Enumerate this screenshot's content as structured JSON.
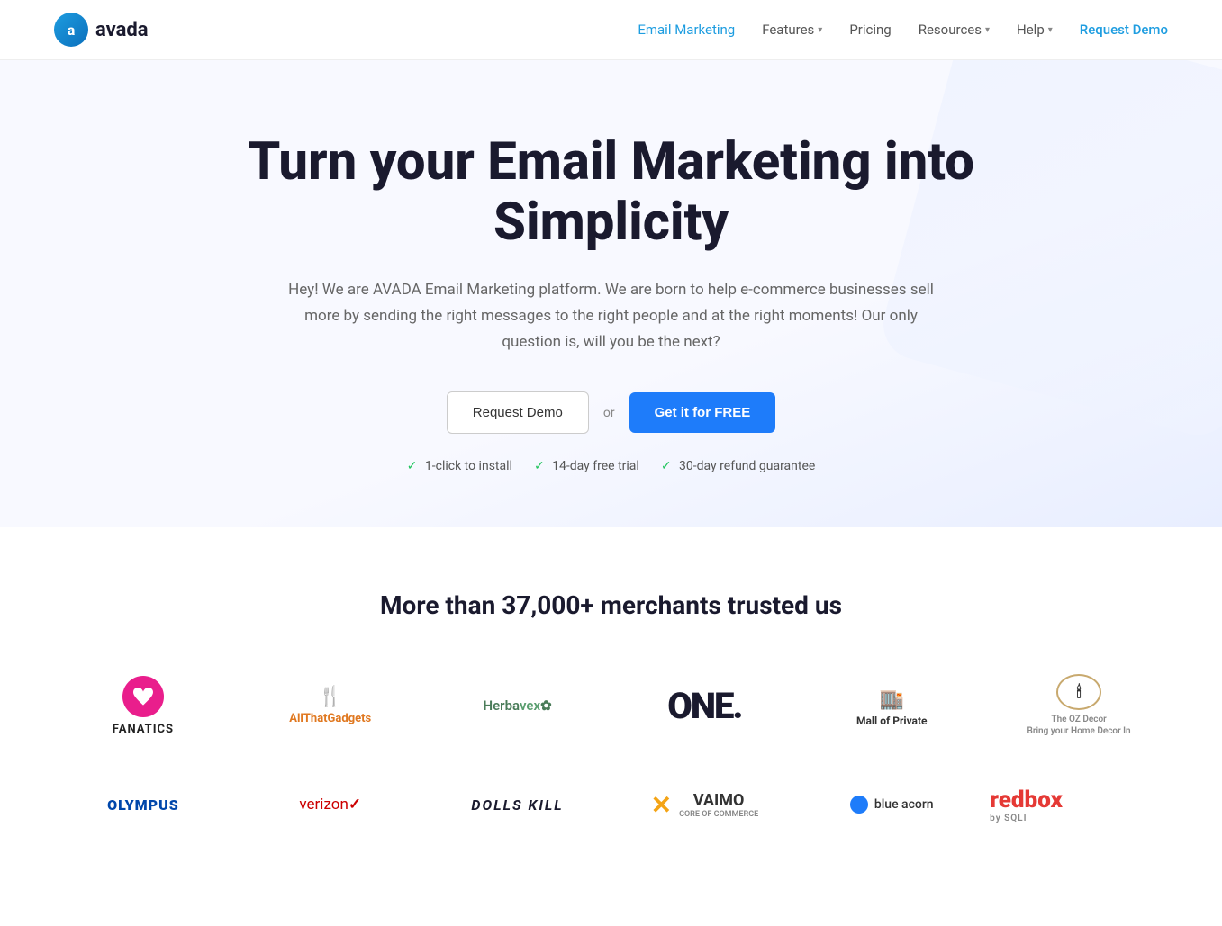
{
  "nav": {
    "logo_letter": "a",
    "logo_name": "avada",
    "links": [
      {
        "id": "email-marketing",
        "label": "Email Marketing",
        "active": true,
        "dropdown": false
      },
      {
        "id": "features",
        "label": "Features",
        "active": false,
        "dropdown": true
      },
      {
        "id": "pricing",
        "label": "Pricing",
        "active": false,
        "dropdown": false
      },
      {
        "id": "resources",
        "label": "Resources",
        "active": false,
        "dropdown": true
      },
      {
        "id": "help",
        "label": "Help",
        "active": false,
        "dropdown": true
      }
    ],
    "cta": "Request Demo"
  },
  "hero": {
    "headline": "Turn your Email Marketing into Simplicity",
    "subtext": "Hey! We are AVADA Email Marketing platform. We are born to help e-commerce businesses sell more by sending the right messages to the right people and at the right moments! Our only question is, will you be the next?",
    "btn_demo": "Request Demo",
    "btn_or": "or",
    "btn_free": "Get it for FREE",
    "badge1": "1-click to install",
    "badge2": "14-day free trial",
    "badge3": "30-day refund guarantee"
  },
  "merchants": {
    "headline": "More than 37,000+ merchants trusted us",
    "row1": [
      {
        "id": "fanatics",
        "label": "FANATICS"
      },
      {
        "id": "allthatgadgets",
        "label": "AllThatGadgets"
      },
      {
        "id": "herbavex",
        "label": "Herbavex"
      },
      {
        "id": "one",
        "label": "ONE."
      },
      {
        "id": "mallofprivate",
        "label": "Mall of Private"
      },
      {
        "id": "ozdecor",
        "label": "The OZ Decor"
      }
    ],
    "row2": [
      {
        "id": "olympus",
        "label": "OLYMPUS"
      },
      {
        "id": "verizon",
        "label": "verizon"
      },
      {
        "id": "dollskill",
        "label": "DOLLS KILL"
      },
      {
        "id": "vaimo",
        "label": "VAIMO"
      },
      {
        "id": "blueacorn",
        "label": "blue acorn"
      },
      {
        "id": "redbox",
        "label": "redbox"
      }
    ]
  }
}
